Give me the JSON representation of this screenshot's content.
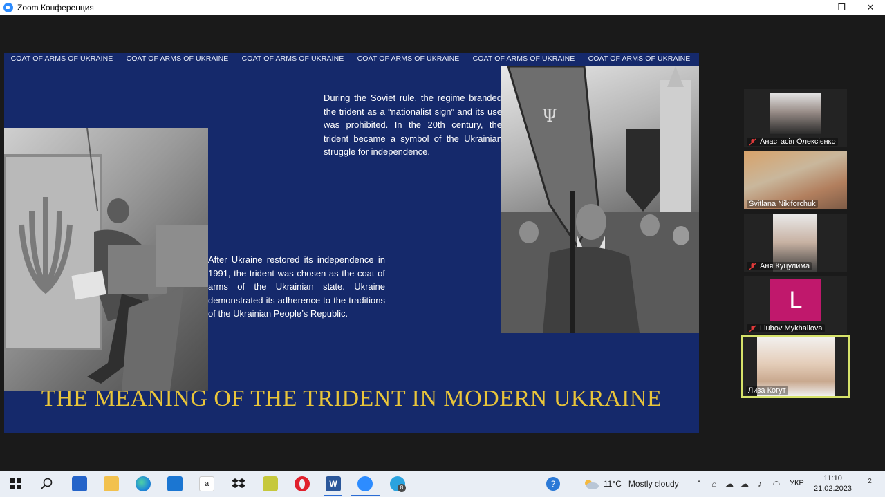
{
  "window": {
    "title": "Zoom Конференция",
    "buttons": {
      "minimize": "—",
      "maximize": "❐",
      "close": "✕"
    }
  },
  "slide": {
    "tabs": [
      "COAT OF ARMS OF UKRAINE",
      "COAT OF ARMS OF UKRAINE",
      "COAT OF ARMS OF UKRAINE",
      "COAT OF ARMS OF UKRAINE",
      "COAT OF ARMS OF UKRAINE",
      "COAT OF ARMS OF UKRAINE"
    ],
    "para1": "During the Soviet rule, the regime branded the trident as a “nationalist sign” and its use was prohibited. In the 20th century, the trident became a symbol of the Ukrainian struggle for independence.",
    "para2": "After Ukraine restored its independence in 1991, the trident was chosen as the coat of arms of the Ukrainian state. Ukraine demonstrated its adherence to the traditions of the Ukrainian People’s Republic.",
    "title": "THE MEANING OF THE TRIDENT IN MODERN UKRAINE",
    "colors": {
      "background": "#15296b",
      "title": "#e9c53a"
    }
  },
  "participants": [
    {
      "name": "Анастасія Олексієнко",
      "muted": true
    },
    {
      "name": "Svitlana Nikiforchuk",
      "muted": false
    },
    {
      "name": "Аня Куцулима",
      "muted": true
    },
    {
      "name": "Liubov Mykhailova",
      "muted": true,
      "avatar_letter": "L"
    },
    {
      "name": "Лиза Когут",
      "muted": false,
      "speaking": true
    }
  ],
  "taskbar": {
    "weather": {
      "temp": "11°C",
      "condition": "Mostly cloudy"
    },
    "language": "УКР",
    "time": "11:10",
    "date": "21.02.2023",
    "notifications": "2",
    "telegram_badge": "8",
    "amazon_label": "a"
  }
}
